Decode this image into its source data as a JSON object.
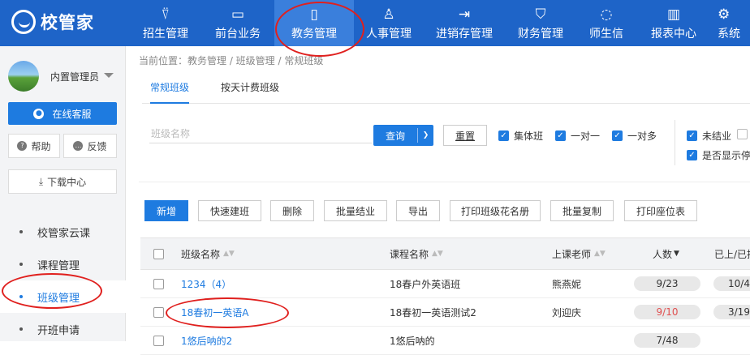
{
  "app": {
    "logo_text": "校管家"
  },
  "nav": [
    {
      "label": "招生管理",
      "icon": "user-plus-icon",
      "glyph": "⍢"
    },
    {
      "label": "前台业务",
      "icon": "monitor-icon",
      "glyph": "▭"
    },
    {
      "label": "教务管理",
      "icon": "book-icon",
      "glyph": "▯"
    },
    {
      "label": "人事管理",
      "icon": "person-icon",
      "glyph": "♙"
    },
    {
      "label": "进销存管理",
      "icon": "box-arrow-icon",
      "glyph": "⇥"
    },
    {
      "label": "财务管理",
      "icon": "money-shield-icon",
      "glyph": "⛉"
    },
    {
      "label": "师生信",
      "icon": "chat-icon",
      "glyph": "◌"
    },
    {
      "label": "报表中心",
      "icon": "chart-icon",
      "glyph": "▥"
    },
    {
      "label": "系统",
      "icon": "settings-icon",
      "glyph": "⚙"
    }
  ],
  "sidebar": {
    "user_name": "内置管理员",
    "service_label": "在线客服",
    "help_label": "帮助",
    "feedback_label": "反馈",
    "download_label": "下载中心",
    "items": [
      {
        "label": "校管家云课"
      },
      {
        "label": "课程管理"
      },
      {
        "label": "班级管理"
      },
      {
        "label": "开班申请"
      }
    ]
  },
  "breadcrumb": "当前位置：教务管理 / 班级管理 / 常规班级",
  "tabs": [
    {
      "label": "常规班级"
    },
    {
      "label": "按天计费班级"
    }
  ],
  "filters": {
    "search_placeholder": "班级名称",
    "query_label": "查询",
    "reset_label": "重置",
    "checks": [
      {
        "label": "集体班",
        "checked": true
      },
      {
        "label": "一对一",
        "checked": true
      },
      {
        "label": "一对多",
        "checked": true
      },
      {
        "label": "未结业",
        "checked": true
      },
      {
        "label": "",
        "checked": false
      },
      {
        "label": "是否显示停",
        "checked": true
      }
    ]
  },
  "toolbar": [
    {
      "label": "新增"
    },
    {
      "label": "快速建班"
    },
    {
      "label": "删除"
    },
    {
      "label": "批量结业"
    },
    {
      "label": "导出"
    },
    {
      "label": "打印班级花名册"
    },
    {
      "label": "批量复制"
    },
    {
      "label": "打印座位表"
    }
  ],
  "table": {
    "headers": {
      "name": "班级名称",
      "course": "课程名称",
      "teacher": "上课老师",
      "count": "人数",
      "progress": "已上/已排"
    },
    "rows": [
      {
        "name": "1234（4）",
        "course": "18春户外英语班",
        "teacher": "熊燕妮",
        "count": "9/23",
        "count_full": false,
        "progress": "10/4"
      },
      {
        "name": "18春初一英语A",
        "course": "18春初一英语测试2",
        "teacher": "刘迎庆",
        "count": "9/10",
        "count_full": true,
        "progress": "3/19"
      },
      {
        "name": "1悠后呐的2",
        "course": "1悠后呐的",
        "teacher": "",
        "count": "7/48",
        "count_full": false,
        "progress": ""
      }
    ]
  }
}
